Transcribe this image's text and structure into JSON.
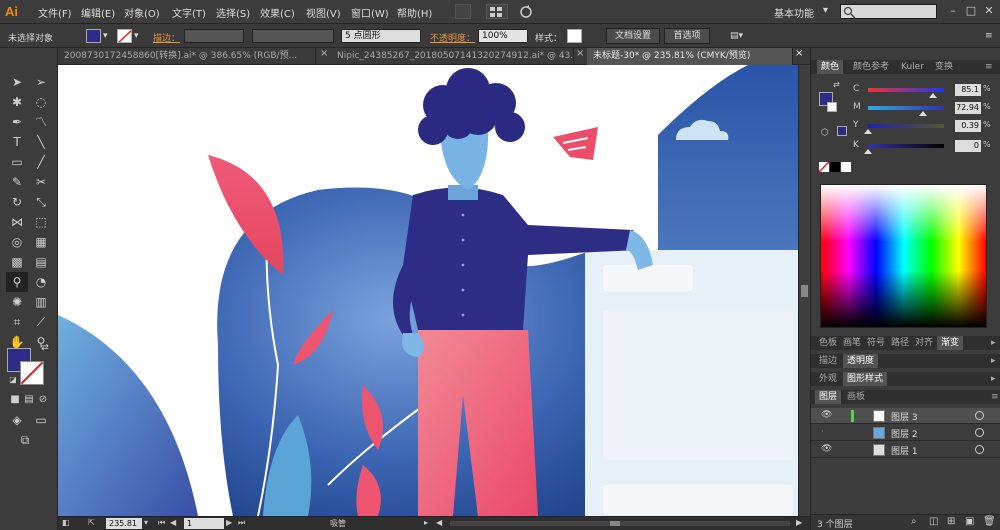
{
  "app": {
    "logo": "Ai",
    "workspace": "基本功能",
    "search_placeholder": ""
  },
  "menu": [
    "文件(F)",
    "编辑(E)",
    "对象(O)",
    "文字(T)",
    "选择(S)",
    "效果(C)",
    "视图(V)",
    "窗口(W)",
    "帮助(H)"
  ],
  "control_bar": {
    "selection": "未选择对象",
    "stroke_label": "描边：",
    "brush_label": "5 点圆形",
    "opacity_label": "不透明度：",
    "opacity_value": "100%",
    "style_label": "样式：",
    "doc_settings": "文档设置",
    "preferences": "首选项"
  },
  "doc_tabs": [
    {
      "label": "20087301724588​60[转换].ai* @ 386.65% (RGB/预...",
      "active": false
    },
    {
      "label": "Nipic_24385267_20180507141320274912.ai* @ 43...",
      "active": false
    },
    {
      "label": "未标题-30* @ 235.81% (CMYK/预览)",
      "active": true
    }
  ],
  "status_bar": {
    "zoom": "235.81",
    "page": "1",
    "tool_name": "吸管"
  },
  "color_panel": {
    "tabs": [
      "颜色",
      "颜色参考",
      "Kuler",
      "变换"
    ],
    "channels": [
      {
        "name": "C",
        "value": "85.1",
        "fraction": 0.851
      },
      {
        "name": "M",
        "value": "72.94",
        "fraction": 0.7294
      },
      {
        "name": "Y",
        "value": "0.39",
        "fraction": 0.0039
      },
      {
        "name": "K",
        "value": "0",
        "fraction": 0
      }
    ],
    "fill_color": "#2e2d86"
  },
  "swatch_tabs": [
    "色板",
    "画笔",
    "符号",
    "路径",
    "对齐",
    "渐变"
  ],
  "stroke_tabs": [
    "描边",
    "透明度"
  ],
  "appearance_tabs": [
    "外观",
    "图形样式"
  ],
  "layers_panel": {
    "tabs": [
      "图层",
      "画板"
    ],
    "layers": [
      {
        "name": "图层 3",
        "selected": true
      },
      {
        "name": "图层 2",
        "selected": false
      },
      {
        "name": "图层 1",
        "selected": false
      }
    ],
    "count": "3 个图层"
  }
}
